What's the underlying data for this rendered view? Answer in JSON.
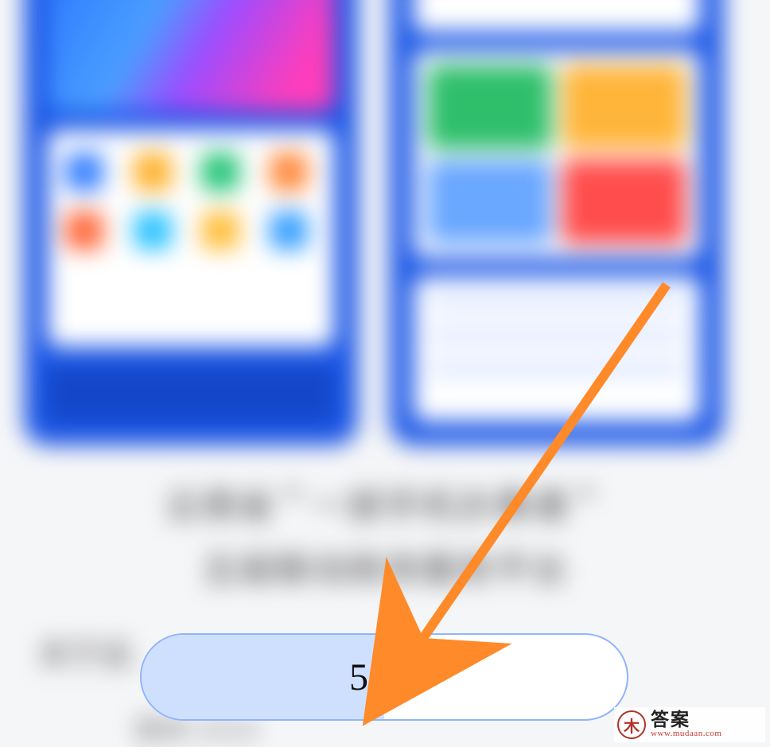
{
  "description": {
    "line1": "云南省＂一部手机办事通＂",
    "line2": "五级联动政务服务平台",
    "about_label": "关于此",
    "version_label": "版本 3.0.0"
  },
  "progress": {
    "percent": 50,
    "text": "50%"
  },
  "watermark": {
    "icon_char": "木",
    "main": "答案",
    "sub": "www.mudaan.com"
  },
  "colors": {
    "brand_blue": "#1b57e6",
    "progress_fill": "#cfe0ff",
    "progress_border": "#8fb4ff",
    "arrow": "#ff8a2a"
  }
}
